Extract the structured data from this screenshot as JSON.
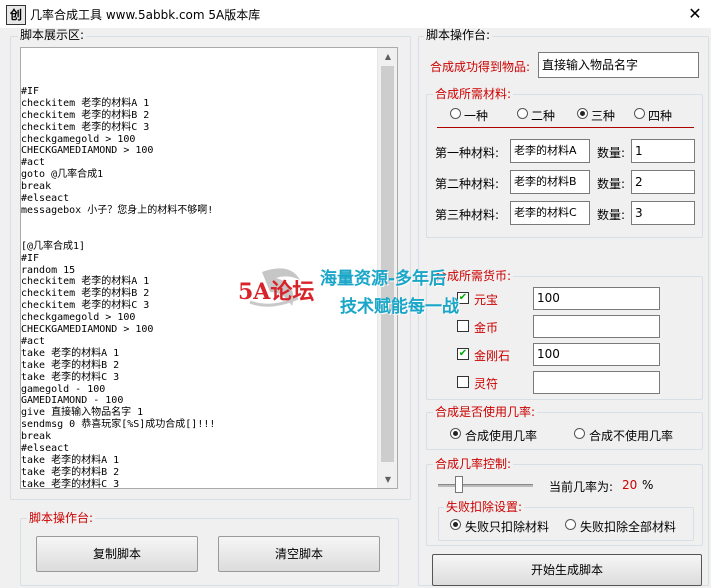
{
  "window": {
    "icon_char": "创",
    "title": "几率合成工具 www.5abbk.com 5A版本库",
    "close": "✕"
  },
  "left": {
    "display_label": "脚本展示区:",
    "script_lines": [
      "",
      "#IF",
      "checkitem 老李的材料A 1",
      "checkitem 老李的材料B 2",
      "checkitem 老李的材料C 3",
      "checkgamegold > 100",
      "CHECKGAMEDIAMOND > 100",
      "#act",
      "goto @几率合成1",
      "break",
      "#elseact",
      "messagebox 小子？您身上的材料不够啊!",
      "",
      "",
      "[@几率合成1]",
      "#IF",
      "random 15",
      "checkitem 老李的材料A 1",
      "checkitem 老李的材料B 2",
      "checkitem 老李的材料C 3",
      "checkgamegold > 100",
      "CHECKGAMEDIAMOND > 100",
      "#act",
      "take 老李的材料A 1",
      "take 老李的材料B 2",
      "take 老李的材料C 3",
      "gamegold - 100",
      "GAMEDIAMOND - 100",
      "give 直接输入物品名字 1",
      "sendmsg 0 恭喜玩家[%S]成功合成[]!!!",
      "break",
      "#elseact",
      "take 老李的材料A 1",
      "take 老李的材料B 2",
      "take 老李的材料C 3"
    ],
    "ops_label": "脚本操作台:",
    "copy_button": "复制脚本",
    "clear_button": "清空脚本"
  },
  "right": {
    "ops_label": "脚本操作台:",
    "result_label": "合成成功得到物品:",
    "result_value": "直接输入物品名字",
    "materials_label": "合成所需材料:",
    "material_count_options": [
      "一种",
      "二种",
      "三种",
      "四种"
    ],
    "material_count_selected": 2,
    "materials": [
      {
        "label": "第一种材料:",
        "name": "老李的材料A",
        "qty_label": "数量:",
        "qty": "1"
      },
      {
        "label": "第二种材料:",
        "name": "老李的材料B",
        "qty_label": "数量:",
        "qty": "2"
      },
      {
        "label": "第三种材料:",
        "name": "老李的材料C",
        "qty_label": "数量:",
        "qty": "3"
      }
    ],
    "currency_label": "合成所需货币:",
    "currencies": [
      {
        "label": "元宝",
        "checked": true,
        "value": "100"
      },
      {
        "label": "金币",
        "checked": false,
        "value": ""
      },
      {
        "label": "金刚石",
        "checked": true,
        "value": "100"
      },
      {
        "label": "灵符",
        "checked": false,
        "value": ""
      }
    ],
    "use_rate_label": "合成是否使用几率:",
    "use_rate_options": [
      "合成使用几率",
      "合成不使用几率"
    ],
    "use_rate_selected": 0,
    "rate_control_label": "合成几率控制:",
    "rate_text": "当前几率为:",
    "rate_value": "20",
    "rate_unit": "%",
    "rate_slider_fraction": 0.2,
    "fail_label": "失败扣除设置:",
    "fail_options": [
      "失败只扣除材料",
      "失败扣除全部材料"
    ],
    "fail_selected": 0,
    "generate_button": "开始生成脚本"
  },
  "watermark": {
    "logo": "5A论坛",
    "line1": "海量资源-多年后",
    "line2": "技术赋能每一战"
  },
  "colors": {
    "label_red": "#cc0000",
    "accent_red_line": "#b00000",
    "watermark_text": "#1aa6c8",
    "watermark_logo": "#d8232a"
  }
}
